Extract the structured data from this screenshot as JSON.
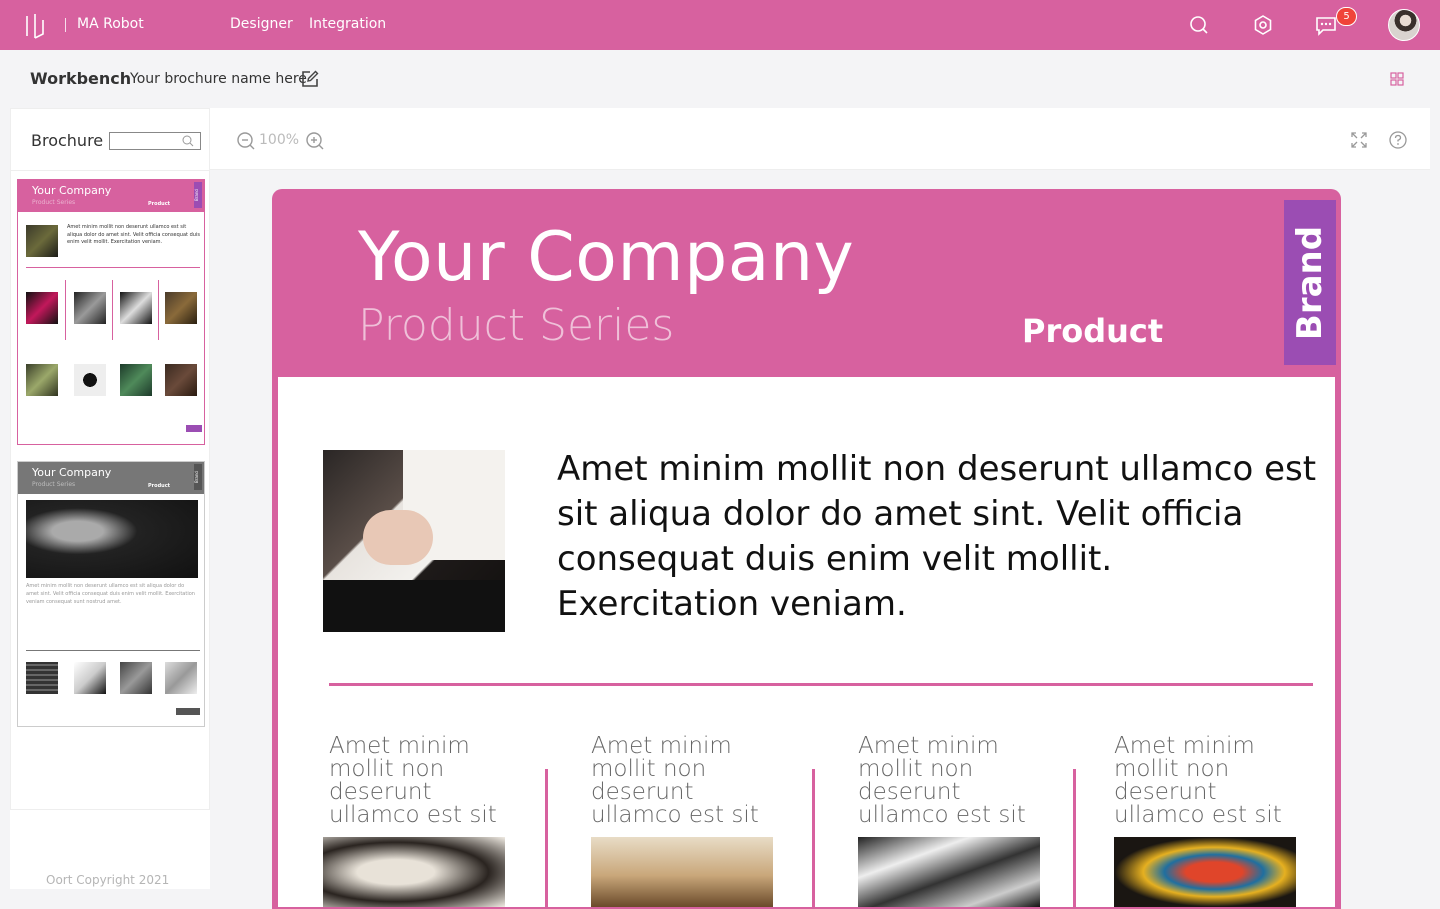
{
  "app": {
    "name": "MA Robot",
    "nav": [
      "Designer",
      "Integration"
    ],
    "notifications": "5"
  },
  "workbench": {
    "title": "Workbench",
    "brochure_name": "Your brochure name here"
  },
  "sidebar": {
    "title": "Brochure",
    "search_placeholder": "",
    "copyright": "Oort Copyright 2021",
    "thumbs": [
      {
        "title": "Your Company",
        "subtitle": "Product Series",
        "product": "Product",
        "brand": "Brand",
        "text": "Amet minim mollit non deserunt ullamco est sit aliqua dolor do amet sint. Velit officia consequat duis enim velit mollit. Exercitation veniam."
      },
      {
        "title": "Your Company",
        "subtitle": "Product Series",
        "product": "Product",
        "brand": "Brand",
        "text": "Amet minim mollit non deserunt ullamco est sit aliqua dolor do amet sint. Velit officia consequat duis enim velit mollit. Exercitation veniam consequat sunt nostrud amet."
      }
    ]
  },
  "toolbar": {
    "zoom": "100%"
  },
  "brochure": {
    "title": "Your Company",
    "subtitle": "Product Series",
    "product": "Product",
    "brand": "Brand",
    "intro": "Amet minim mollit non deserunt ullamco est sit aliqua dolor do amet sint. Velit officia consequat duis enim velit mollit. Exercitation veniam.",
    "columns": [
      "Amet minim mollit non deserunt ullamco est sit",
      "Amet minim mollit non deserunt ullamco est sit",
      "Amet minim mollit non deserunt ullamco est sit",
      "Amet minim mollit non deserunt ullamco est sit"
    ]
  },
  "colors": {
    "accent": "#d7619f",
    "brand": "#9b4db3",
    "badge": "#f0443a"
  }
}
